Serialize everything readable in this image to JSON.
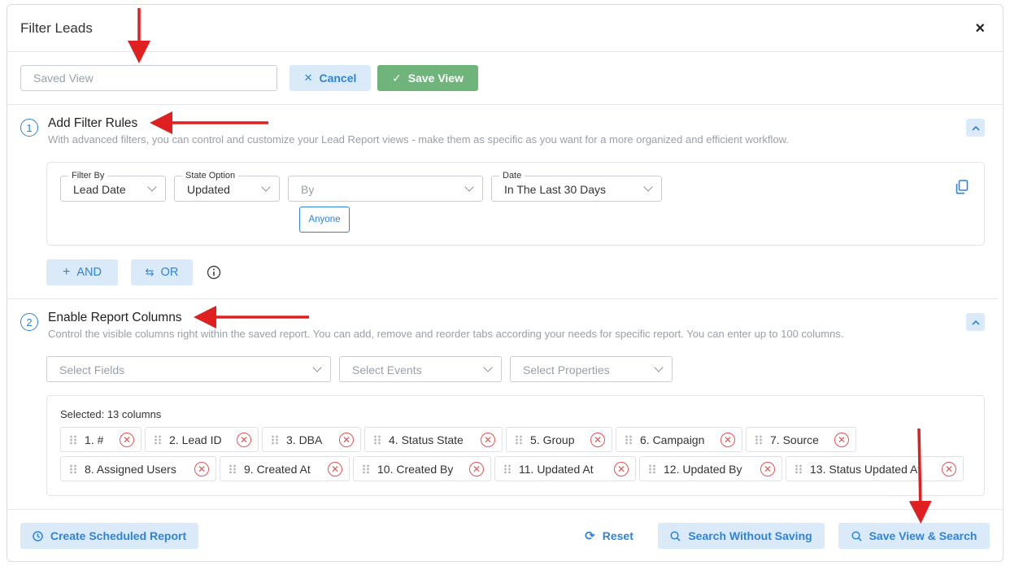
{
  "modal": {
    "title": "Filter Leads",
    "close_symbol": "×"
  },
  "saved_view": {
    "placeholder": "Saved View",
    "value": ""
  },
  "actions": {
    "cancel_label": "Cancel",
    "save_label": "Save View"
  },
  "filter_section": {
    "number": "1",
    "title": "Add Filter Rules",
    "description": "With advanced filters, you can control and customize your Lead Report views - make them as specific as you want for a more organized and efficient workflow.",
    "filter_by": {
      "label": "Filter By",
      "value": "Lead Date"
    },
    "state_option": {
      "label": "State Option",
      "value": "Updated"
    },
    "by": {
      "placeholder": "By"
    },
    "date": {
      "label": "Date",
      "value": "In The Last 30 Days"
    },
    "anyone_label": "Anyone",
    "and_label": "AND",
    "or_label": "OR"
  },
  "columns_section": {
    "number": "2",
    "title": "Enable Report Columns",
    "description": "Control the visible columns right within the saved report. You can add, remove and reorder tabs according your needs for specific report. You can enter up to 100 columns.",
    "select_fields": "Select Fields",
    "select_events": "Select Events",
    "select_properties": "Select Properties",
    "selected_label": "Selected: 13 columns",
    "columns": [
      "1. #",
      "2. Lead ID",
      "3. DBA",
      "4. Status State",
      "5. Group",
      "6. Campaign",
      "7. Source",
      "8. Assigned Users",
      "9. Created At",
      "10. Created By",
      "11. Updated At",
      "12. Updated By",
      "13. Status Updated At"
    ]
  },
  "footer": {
    "create_scheduled_label": "Create Scheduled Report",
    "reset_label": "Reset",
    "search_without_saving_label": "Search Without Saving",
    "save_view_search_label": "Save View & Search"
  },
  "colors": {
    "accent": "#2f84d8",
    "accent_bg": "#dbeaf9",
    "success": "#6fb57b",
    "danger": "#e55353",
    "annotation_arrow": "#e02020"
  }
}
